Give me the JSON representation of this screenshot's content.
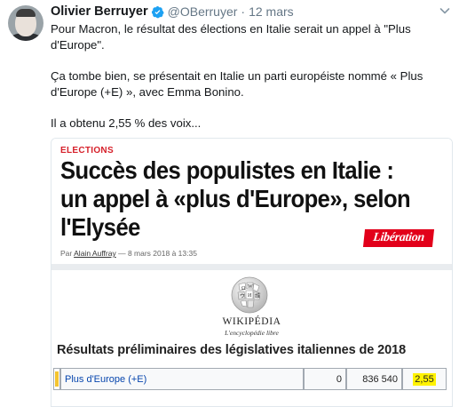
{
  "tweet": {
    "author_name": "Olivier Berruyer",
    "handle": "@OBerruyer",
    "separator": "·",
    "date": "12 mars",
    "text_paragraphs": [
      "Pour Macron, le résultat des élections en Italie serait un appel à \"Plus d'Europe\".",
      "Ça tombe bien, se présentait en Italie un parti européiste nommé « Plus d'Europe (+E) », avec Emma Bonino.",
      "Il a obtenu 2,55 % des voix..."
    ]
  },
  "article": {
    "kicker": "ELECTIONS",
    "headline": "Succès des populistes en Italie : un appel à «plus d'Europe», selon l'Elysée",
    "byline_prefix": "Par",
    "byline_author": "Alain Auffray",
    "byline_date": "— 8 mars 2018 à 13:35",
    "logo_text": "Libération"
  },
  "wikipedia": {
    "wordmark": "WIKIPÉDIA",
    "tagline": "L'encyclopédie libre",
    "results_title": "Résultats préliminaires des législatives italiennes de 2018",
    "row": {
      "party": "Plus d'Europe (+E)",
      "seats": "0",
      "votes": "836 540",
      "percent": "2,55"
    }
  },
  "colors": {
    "verified_blue": "#1da1f2",
    "liberation_red": "#e2001a",
    "party_swatch": "#f4c430",
    "highlight": "#fff200"
  },
  "icons": [
    "verified-icon",
    "chevron-down-icon",
    "wikipedia-globe-icon"
  ]
}
